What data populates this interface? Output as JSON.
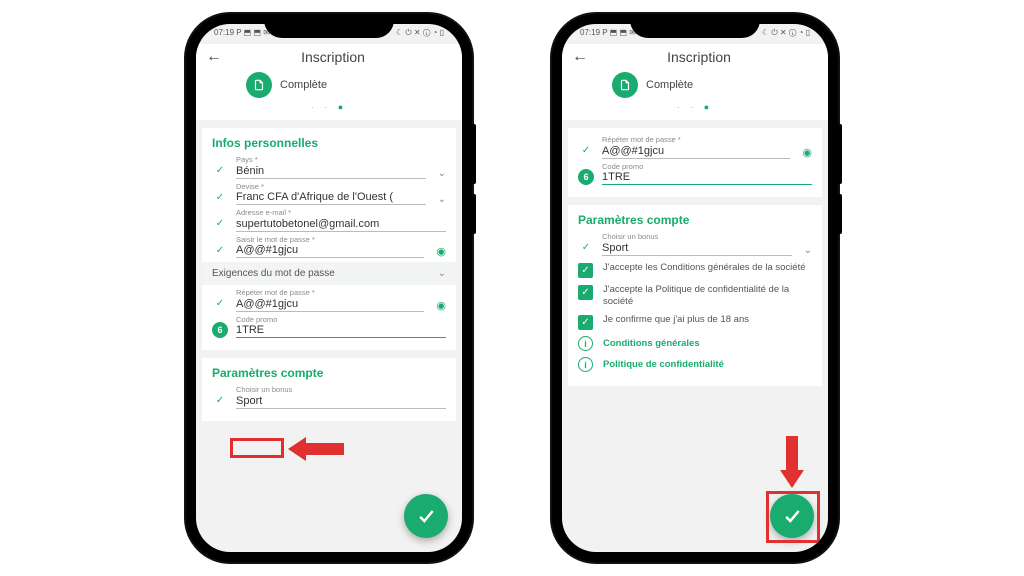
{
  "status": {
    "time": "07:19",
    "icons": "P ⬒ ⬒ ✉ …",
    "right": "☾ ⏻ ✕ ⓘ ◔ ▯"
  },
  "header": {
    "title": "Inscription",
    "step_label": "Complète"
  },
  "left": {
    "section_personal": "Infos personnelles",
    "country": {
      "label": "Pays *",
      "value": "Bénin"
    },
    "currency": {
      "label": "Devise *",
      "value": "Franc CFA d'Afrique de l'Ouest ("
    },
    "email": {
      "label": "Adresse e-mail *",
      "value": "supertutobetonel@gmail.com"
    },
    "pwd": {
      "label": "Saisir le mot de passe *",
      "value": "A@@#1gjcu"
    },
    "pwd_req": "Exigences du mot de passe",
    "pwd2": {
      "label": "Répéter mot de passe *",
      "value": "A@@#1gjcu"
    },
    "promo": {
      "label": "Code promo",
      "value": "1TRE",
      "badge": "6"
    },
    "section_account": "Paramètres compte",
    "bonus": {
      "label": "Choisir un bonus",
      "value": "Sport"
    }
  },
  "right": {
    "pwd2": {
      "label": "Répéter mot de passe *",
      "value": "A@@#1gjcu"
    },
    "promo": {
      "label": "Code promo",
      "value": "1TRE",
      "badge": "6"
    },
    "section_account": "Paramètres compte",
    "bonus": {
      "label": "Choisir un bonus",
      "value": "Sport"
    },
    "consent1": "J'accepte les Conditions générales de la société",
    "consent2": "J'accepte la Politique de confidentialité de la société",
    "consent3": "Je confirme que j'ai plus de 18 ans",
    "link1": "Conditions générales",
    "link2": "Politique de confidentialité"
  }
}
